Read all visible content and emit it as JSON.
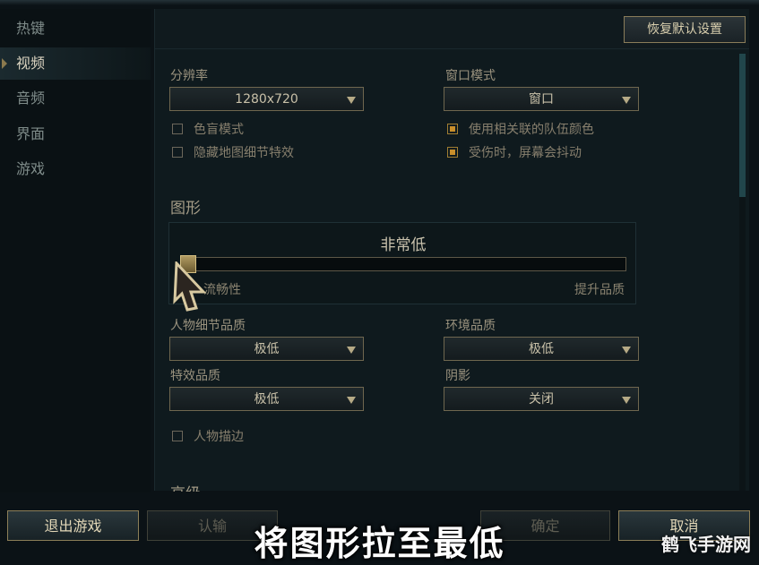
{
  "sidebar": {
    "items": [
      {
        "label": "热键"
      },
      {
        "label": "视频"
      },
      {
        "label": "音频"
      },
      {
        "label": "界面"
      },
      {
        "label": "游戏"
      }
    ],
    "active_index": 1
  },
  "header": {
    "reset_label": "恢复默认设置"
  },
  "resolution": {
    "label": "分辨率",
    "value": "1280x720"
  },
  "window_mode": {
    "label": "窗口模式",
    "value": "窗口"
  },
  "checks_left": [
    {
      "label": "色盲模式",
      "checked": false
    },
    {
      "label": "隐藏地图细节特效",
      "checked": false
    }
  ],
  "checks_right": [
    {
      "label": "使用相关联的队伍颜色",
      "checked": true
    },
    {
      "label": "受伤时，屏幕会抖动",
      "checked": true
    }
  ],
  "graphics": {
    "title": "图形",
    "level": "非常低",
    "slider_value": 0,
    "left_label": "流畅性",
    "right_label": "提升品质"
  },
  "character_quality": {
    "label": "人物细节品质",
    "value": "极低"
  },
  "environment_quality": {
    "label": "环境品质",
    "value": "极低"
  },
  "effects_quality": {
    "label": "特效品质",
    "value": "极低"
  },
  "shadows": {
    "label": "阴影",
    "value": "关闭"
  },
  "outline": {
    "label": "人物描边",
    "checked": false
  },
  "advanced": {
    "title": "高级"
  },
  "footer": {
    "exit_label": "退出游戏",
    "surrender_label": "认输",
    "confirm_label": "确定",
    "cancel_label": "取消"
  },
  "overlay": {
    "subtitle": "将图形拉至最低",
    "watermark": "鹤飞手游网"
  },
  "colors": {
    "accent_gold": "#c98f2b",
    "border_gold": "#8c7f58",
    "scroll_teal": "#21464b"
  }
}
